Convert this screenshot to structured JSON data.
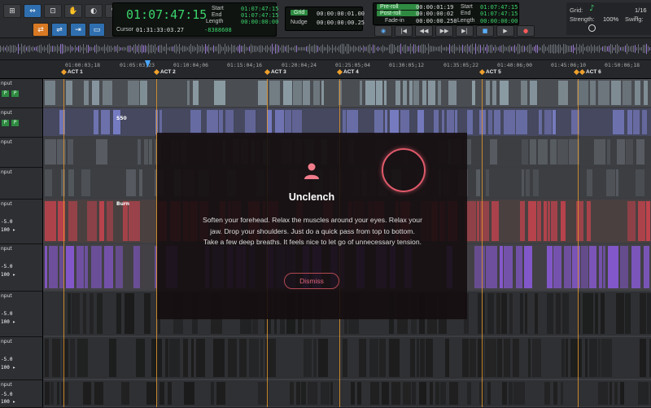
{
  "counters": {
    "main": "01:07:47:15",
    "start_label": "Start",
    "end_label": "End",
    "length_label": "Length",
    "start": "01:07:47:15",
    "end": "01:07:47:15",
    "length": "00:00:00:00",
    "cursor_label": "Cursor",
    "cursor": "01:31:33:03.27",
    "sample": "-8388608"
  },
  "grid": {
    "grid_label": "Grid",
    "grid_value": "00:00:00:01.00",
    "nudge_label": "Nudge",
    "nudge_value": "00:00:00:00.25"
  },
  "roll": {
    "preroll_label": "Pre-roll",
    "preroll_value": "00:00:01:19",
    "postroll_label": "Post-roll",
    "postroll_value": "00:00:00:02",
    "fadein_label": "Fade-in",
    "fadein_value": "00:00:00.250",
    "start_label": "Start",
    "end_label": "End",
    "length_label": "Length",
    "start": "01:07:47:15",
    "end": "01:07:47:15",
    "length": "00:00:00:00"
  },
  "right_panel": {
    "grid_label": "Grid:",
    "grid_value": "1/16 n",
    "strength_label": "Strength:",
    "strength_value": "100%",
    "swing_label": "Swing:"
  },
  "ruler": {
    "timecodes": [
      "01:00:03;18",
      "01:05:03;23",
      "01:10:04;06",
      "01:15:04;16",
      "01:20:04;24",
      "01:25:05;04",
      "01:30:05;12",
      "01:35:05;22",
      "01:40:06;00",
      "01:45:06;10",
      "01:50:06;18"
    ],
    "markers": [
      "ACT 1",
      "ACT 2",
      "ACT 3",
      "ACT 4",
      "ACT 5",
      "ACT 6"
    ]
  },
  "tracks": [
    {
      "name": "nput",
      "vol": "",
      "pan": ""
    },
    {
      "name": "nput",
      "vol": "",
      "pan": ""
    },
    {
      "name": "nput",
      "vol": "",
      "pan": ""
    },
    {
      "name": "nput",
      "vol": "",
      "pan": ""
    },
    {
      "name": "nput",
      "vol": "-5.0",
      "pan": "100 ▸"
    },
    {
      "name": "nput",
      "vol": "-5.0",
      "pan": "100 ▸"
    },
    {
      "name": "nput",
      "vol": "-5.0",
      "pan": "100 ▸"
    },
    {
      "name": "nput",
      "vol": "-5.0",
      "pan": "100 ▸"
    },
    {
      "name": "nput",
      "vol": "-5.0",
      "pan": "100 ▸"
    }
  ],
  "clip_labels": [
    "S50",
    "Burn"
  ],
  "modal": {
    "title": "Unclench",
    "body": "Soften your forehead. Relax the muscles around your eyes. Relax your jaw. Drop your shoulders. Just do a quick pass from top to bottom. Take a few deep breaths. It feels nice to let go of unnecessary tension.",
    "dismiss_label": "Dismiss"
  },
  "colors": {
    "accent_orange": "#e3962c",
    "lcd_green": "#3bd46b",
    "modal_accent": "#e05a6a",
    "clip_purple": "#8a5ad8",
    "clip_red": "#c9434e"
  }
}
